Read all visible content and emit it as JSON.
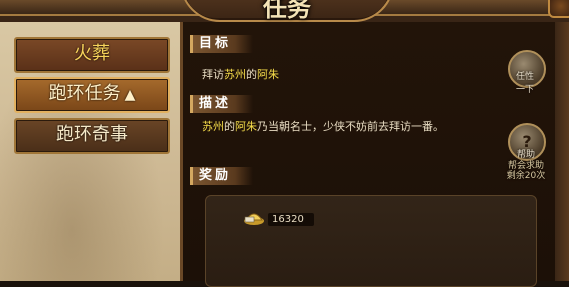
{
  "window": {
    "title": "任务"
  },
  "tabs": [
    {
      "label": "火葬"
    },
    {
      "label": "跑环任务",
      "arrow": "▲"
    },
    {
      "label": "跑环奇事"
    }
  ],
  "sections": {
    "goal_label": "目标",
    "desc_label": "描述",
    "reward_label": "奖励"
  },
  "goal": {
    "prefix": "拜访",
    "city": "苏州",
    "mid": "的",
    "npc": "阿朱"
  },
  "description": {
    "city": "苏州",
    "mid": "的",
    "npc": "阿朱",
    "rest": "乃当朝名士，少侠不妨前去拜访一番。"
  },
  "reward": {
    "value": "16320",
    "icon": "ingot-icon"
  },
  "side_buttons": {
    "task_top_icon": "task-icon",
    "task_top_label_1": "任性",
    "task_top_label_2": "一下",
    "help_icon": "question-icon",
    "help_label": "帮助",
    "help_line1": "帮会求助",
    "help_line2": "剩余20次"
  },
  "colors": {
    "highlight": "#f5dc4a",
    "text": "#e8dcc2",
    "frame": "#a07638"
  }
}
